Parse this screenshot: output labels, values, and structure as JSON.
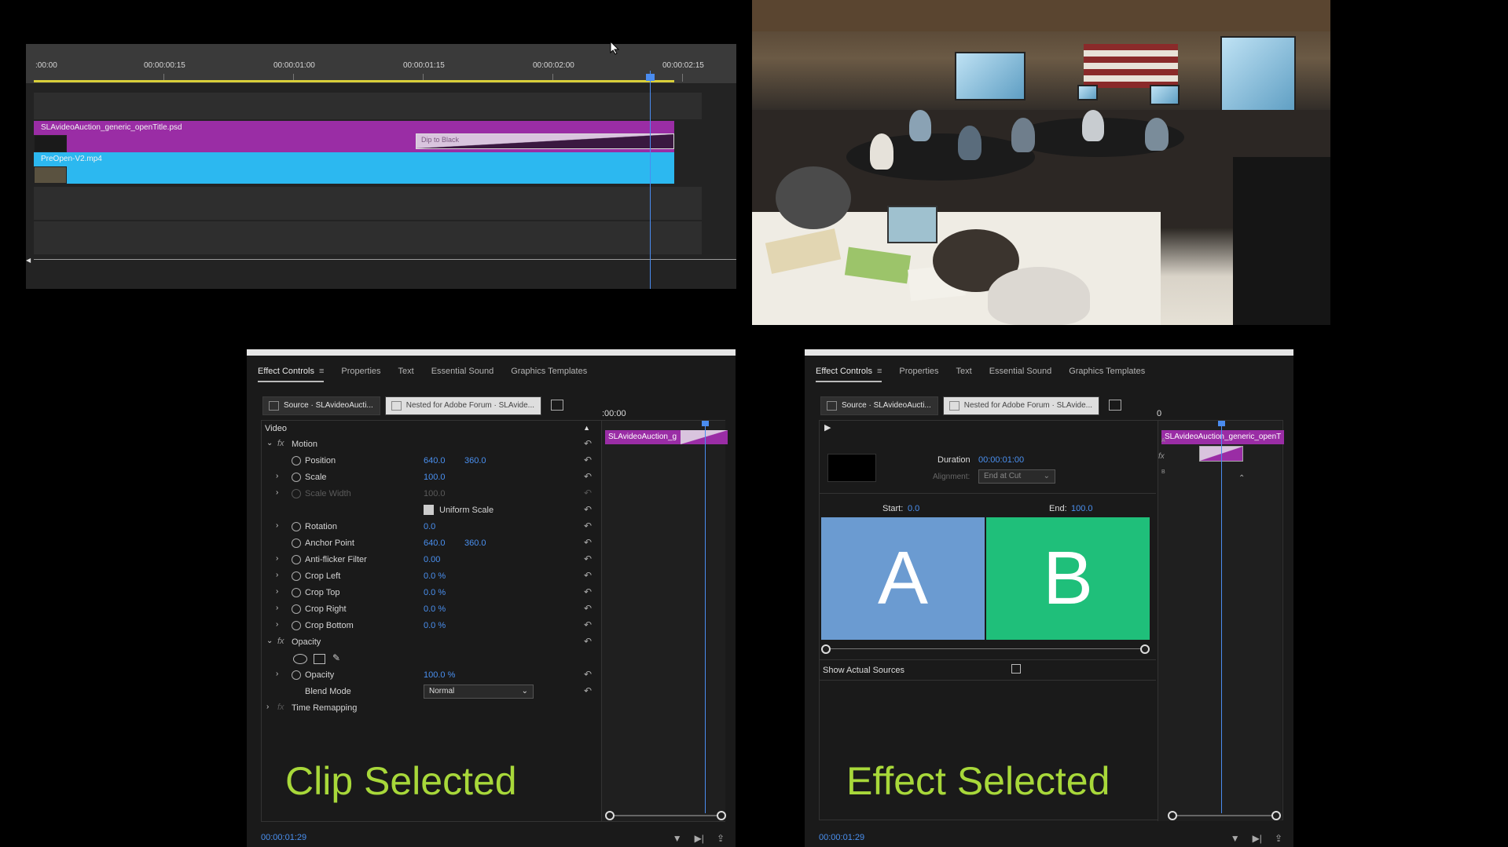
{
  "timeline": {
    "ruler_ticks": [
      ":00:00",
      "00:00:00:15",
      "00:00:01:00",
      "00:00:01:15",
      "00:00:02:00",
      "00:00:02:15"
    ],
    "clips": {
      "title_clip": "SLAvideoAuction_generic_openTitle.psd",
      "video_clip": "PreOpen-V2.mp4",
      "transition": "Dip to Black"
    }
  },
  "panel_clip": {
    "tabs": [
      "Effect Controls",
      "Properties",
      "Text",
      "Essential Sound",
      "Graphics Templates"
    ],
    "source_label": "Source · SLAvideoAucti...",
    "sequence_label": "Nested for Adobe Forum · SLAvide...",
    "mini_timecode": ":00:00",
    "mini_clip": "SLAvideoAuction_g",
    "section_video": "Video",
    "motion": "Motion",
    "rows": [
      {
        "label": "Position",
        "v1": "640.0",
        "v2": "360.0"
      },
      {
        "label": "Scale",
        "v1": "100.0",
        "v2": ""
      },
      {
        "label": "Scale Width",
        "v1": "100.0",
        "v2": ""
      },
      {
        "label": "Uniform Scale",
        "v1": "",
        "v2": ""
      },
      {
        "label": "Rotation",
        "v1": "0.0",
        "v2": ""
      },
      {
        "label": "Anchor Point",
        "v1": "640.0",
        "v2": "360.0"
      },
      {
        "label": "Anti-flicker Filter",
        "v1": "0.00",
        "v2": ""
      },
      {
        "label": "Crop Left",
        "v1": "0.0 %",
        "v2": ""
      },
      {
        "label": "Crop Top",
        "v1": "0.0 %",
        "v2": ""
      },
      {
        "label": "Crop Right",
        "v1": "0.0 %",
        "v2": ""
      },
      {
        "label": "Crop Bottom",
        "v1": "0.0 %",
        "v2": ""
      }
    ],
    "opacity_section": "Opacity",
    "opacity_row": {
      "label": "Opacity",
      "v1": "100.0 %"
    },
    "blend_mode_label": "Blend Mode",
    "blend_mode_value": "Normal",
    "time_remapping": "Time Remapping",
    "caption": "Clip Selected",
    "timecode": "00:00:01:29"
  },
  "panel_effect": {
    "tabs": [
      "Effect Controls",
      "Properties",
      "Text",
      "Essential Sound",
      "Graphics Templates"
    ],
    "source_label": "Source · SLAvideoAucti...",
    "sequence_label": "Nested for Adobe Forum · SLAvide...",
    "mini_timecode": "0",
    "mini_clip": "SLAvideoAuction_generic_openT",
    "duration_label": "Duration",
    "duration_value": "00:00:01:00",
    "alignment_label": "Alignment:",
    "alignment_value": "End at Cut",
    "start_label": "Start:",
    "start_value": "0.0",
    "end_label": "End:",
    "end_value": "100.0",
    "a_label": "A",
    "b_label": "B",
    "a_color": "#6b9bd1",
    "b_color": "#1fbf7a",
    "show_actual_sources": "Show Actual Sources",
    "caption": "Effect Selected",
    "timecode": "00:00:01:29"
  },
  "colors": {
    "accent_blue": "#4a90f0",
    "title_clip": "#9a2da5",
    "video_clip": "#2cb8f0",
    "caption_green": "#a8d83a"
  }
}
